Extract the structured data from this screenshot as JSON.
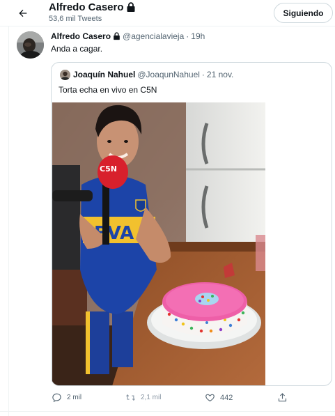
{
  "header": {
    "name": "Alfredo Casero",
    "tweet_count": "53,6 mil Tweets",
    "follow_label": "Siguiendo"
  },
  "tweet": {
    "author_name": "Alfredo Casero",
    "handle": "@agencialavieja",
    "separator": "·",
    "time": "19h",
    "text": "Anda a cagar."
  },
  "quote": {
    "author_name": "Joaquín Nahuel",
    "handle": "@JoaqunNahuel",
    "separator": "·",
    "time": "21 nov.",
    "text": "Torta echa en vivo en C5N",
    "photo": {
      "mic_flag": "C5N",
      "shirt_text": "BVA"
    }
  },
  "actions": {
    "replies": "2 mil",
    "retweets": "2,1 mil",
    "likes": "442"
  },
  "colors": {
    "text": "#0f1419",
    "secondary": "#536471",
    "border": "#cfd9de"
  },
  "icons": [
    "back-arrow-icon",
    "lock-icon",
    "reply-icon",
    "retweet-icon",
    "like-icon",
    "share-icon"
  ]
}
